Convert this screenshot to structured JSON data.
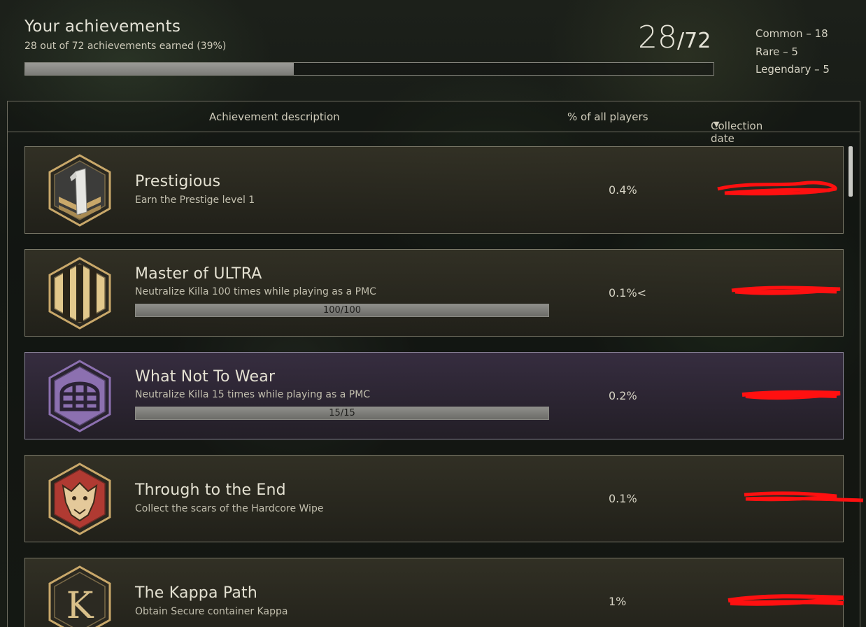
{
  "header": {
    "title": "Your achievements",
    "subtitle": "28 out of 72 achievements earned (39%)",
    "earned": "28",
    "slash": "/",
    "total": "72",
    "progress_fraction": 0.39,
    "rarity": {
      "common": "Common – 18",
      "rare": "Rare – 5",
      "legendary": "Legendary – 5"
    }
  },
  "columns": {
    "description": "Achievement description",
    "percent": "% of all players",
    "date": "Collection date"
  },
  "achievements": [
    {
      "title": "Prestigious",
      "description": "Earn the Prestige level 1",
      "percent": "0.4%",
      "badge": "prestige-1-icon",
      "progress_text": null
    },
    {
      "title": "Master of ULTRA",
      "description": "Neutralize Killa 100 times while playing as a PMC",
      "percent": "0.1%<",
      "badge": "stripes-icon",
      "progress_text": "100/100",
      "progress_fraction": 1.0
    },
    {
      "title": "What Not To Wear",
      "description": "Neutralize Killa 15 times while playing as a PMC",
      "percent": "0.2%",
      "badge": "helmet-icon",
      "progress_text": "15/15",
      "progress_fraction": 1.0
    },
    {
      "title": "Through to the End",
      "description": "Collect the scars of the Hardcore Wipe",
      "percent": "0.1%",
      "badge": "beast-icon",
      "progress_text": null
    },
    {
      "title": "The Kappa Path",
      "description": "Obtain Secure container Kappa",
      "percent": "1%",
      "badge": "kappa-icon",
      "progress_text": null
    }
  ],
  "colors": {
    "gold": "#c9a86a",
    "purple": "#8c70b0",
    "red": "#b03a32",
    "redact": "#ff1010"
  }
}
